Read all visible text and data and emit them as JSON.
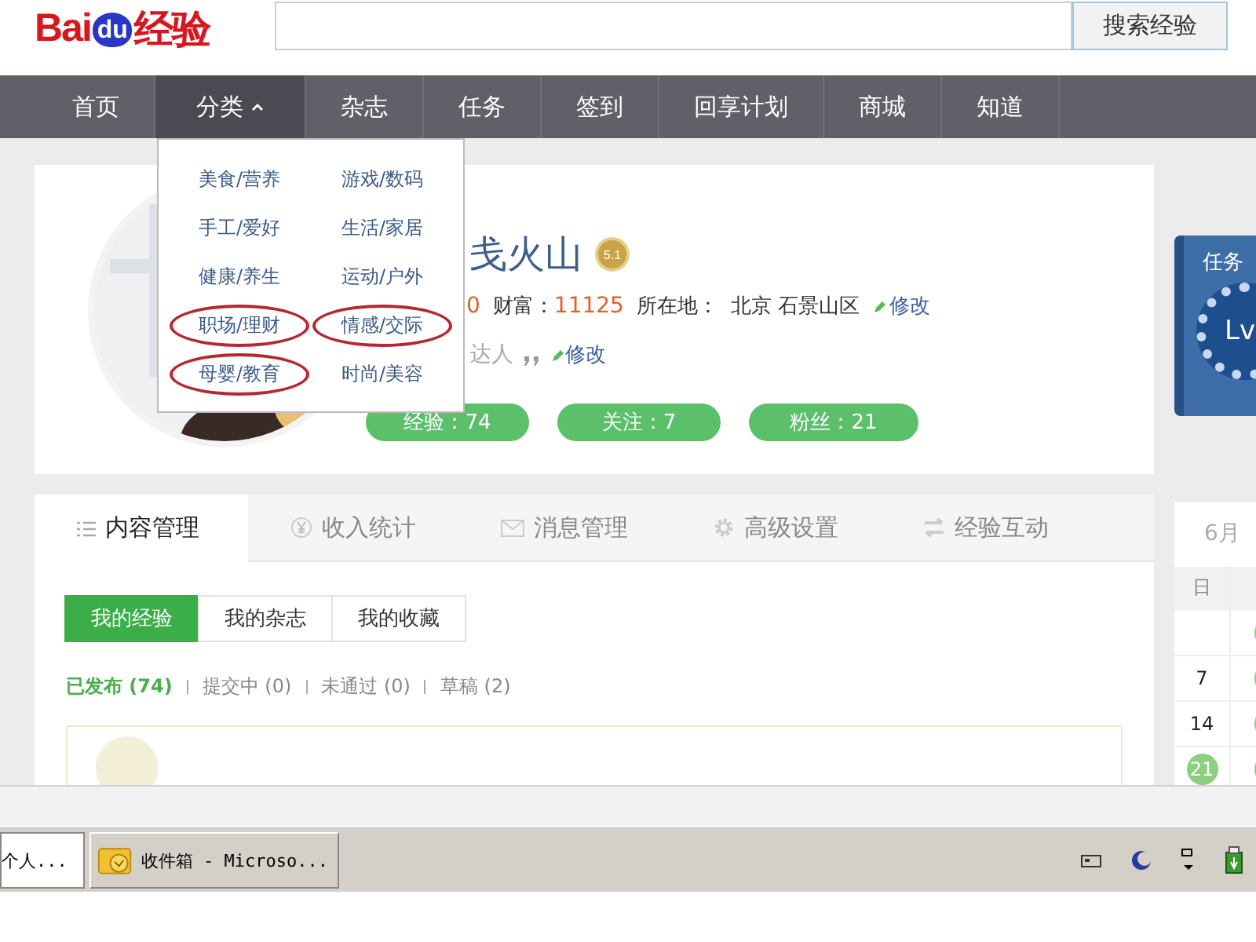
{
  "logo": {
    "lead": "Bai",
    "paw": "du",
    "tail": "经验"
  },
  "search": {
    "button": "搜索经验"
  },
  "nav": [
    {
      "label": "首页",
      "selected": false,
      "dropdown": false
    },
    {
      "label": "分类",
      "selected": true,
      "dropdown": true
    },
    {
      "label": "杂志",
      "selected": false,
      "dropdown": false
    },
    {
      "label": "任务",
      "selected": false,
      "dropdown": false
    },
    {
      "label": "签到",
      "selected": false,
      "dropdown": false
    },
    {
      "label": "回享计划",
      "selected": false,
      "dropdown": false
    },
    {
      "label": "商城",
      "selected": false,
      "dropdown": false
    },
    {
      "label": "知道",
      "selected": false,
      "dropdown": false
    }
  ],
  "category_menu": [
    {
      "label": "美食/营养",
      "circled": false
    },
    {
      "label": "游戏/数码",
      "circled": false
    },
    {
      "label": "手工/爱好",
      "circled": false
    },
    {
      "label": "生活/家居",
      "circled": false
    },
    {
      "label": "健康/养生",
      "circled": false
    },
    {
      "label": "运动/户外",
      "circled": false
    },
    {
      "label": "职场/理财",
      "circled": true
    },
    {
      "label": "情感/交际",
      "circled": true
    },
    {
      "label": "母婴/教育",
      "circled": true
    },
    {
      "label": "时尚/美容",
      "circled": false
    }
  ],
  "profile": {
    "name": "戋火山",
    "medal": "5.1",
    "stat_value": "0",
    "wealth_label": "财富：",
    "wealth": "11125",
    "location_label": "所在地：",
    "location": "北京 石景山区",
    "edit": "修改",
    "title": "达人",
    "title_edit": "修改",
    "pills": [
      "经验：74",
      "关注：7",
      "粉丝：21"
    ]
  },
  "task_panel": {
    "title": "任务",
    "level": "Lv"
  },
  "tabs": [
    {
      "label": "内容管理",
      "selected": true
    },
    {
      "label": "收入统计",
      "selected": false
    },
    {
      "label": "消息管理",
      "selected": false
    },
    {
      "label": "高级设置",
      "selected": false
    },
    {
      "label": "经验互动",
      "selected": false
    }
  ],
  "subtabs": [
    {
      "label": "我的经验",
      "selected": true
    },
    {
      "label": "我的杂志",
      "selected": false
    },
    {
      "label": "我的收藏",
      "selected": false
    }
  ],
  "filters": [
    {
      "label": "已发布 (74)",
      "selected": true
    },
    {
      "label": "提交中 (0)",
      "selected": false
    },
    {
      "label": "未通过 (0)",
      "selected": false
    },
    {
      "label": "草稿 (2)",
      "selected": false
    }
  ],
  "calendar": {
    "month": "6月",
    "weekday": "日",
    "rows": [
      {
        "next_marked": true
      },
      {
        "day": "7",
        "marked": false,
        "next_marked": true
      },
      {
        "day": "14",
        "marked": false,
        "next_marked": true
      },
      {
        "day": "21",
        "marked": true,
        "next_marked": true
      }
    ]
  },
  "taskbar": [
    {
      "label": "个人...",
      "kind": "plain",
      "selected": true
    },
    {
      "label": "收件箱 - Microso...",
      "kind": "mail",
      "selected": false
    }
  ]
}
